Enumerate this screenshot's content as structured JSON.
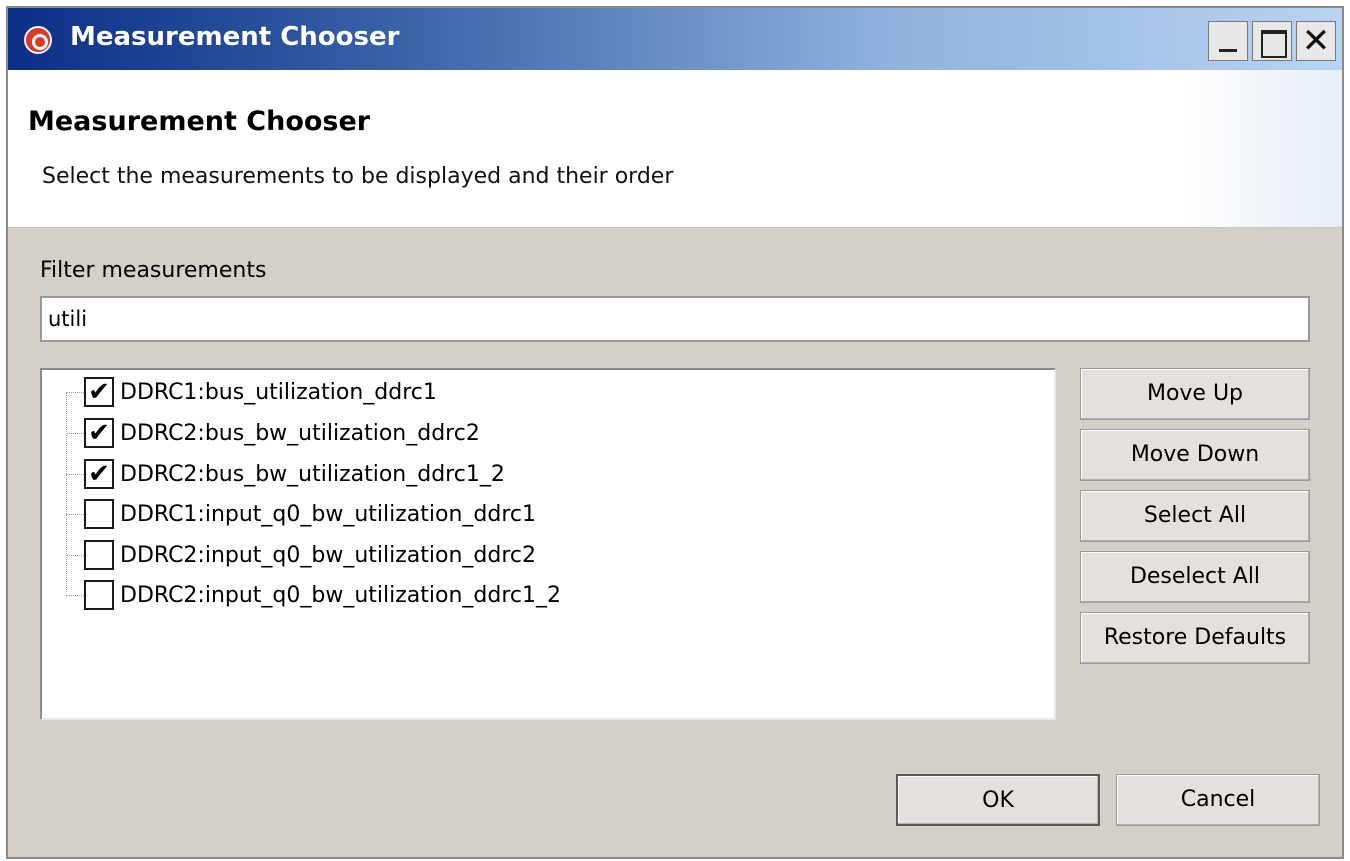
{
  "window": {
    "title": "Measurement Chooser",
    "controls": {
      "minimize": "_",
      "maximize": "□",
      "close": "✕"
    }
  },
  "banner": {
    "title": "Measurement Chooser",
    "subtitle": "Select the measurements to be displayed and their order"
  },
  "filter": {
    "label": "Filter measurements",
    "value": "utili"
  },
  "measurements": [
    {
      "label": "DDRC1:bus_utilization_ddrc1",
      "checked": true
    },
    {
      "label": "DDRC2:bus_bw_utilization_ddrc2",
      "checked": true
    },
    {
      "label": "DDRC2:bus_bw_utilization_ddrc1_2",
      "checked": true
    },
    {
      "label": "DDRC1:input_q0_bw_utilization_ddrc1",
      "checked": false
    },
    {
      "label": "DDRC2:input_q0_bw_utilization_ddrc2",
      "checked": false
    },
    {
      "label": "DDRC2:input_q0_bw_utilization_ddrc1_2",
      "checked": false
    }
  ],
  "side_buttons": {
    "move_up": "Move Up",
    "move_down": "Move Down",
    "select_all": "Select All",
    "deselect_all": "Deselect All",
    "restore_defaults": "Restore Defaults"
  },
  "footer": {
    "ok": "OK",
    "cancel": "Cancel"
  },
  "colors": {
    "titlebar_start": "#0b2e86",
    "titlebar_end": "#b9d4f2",
    "dialog_background": "#d4d0c8"
  },
  "icons": {
    "app": "app-logo-icon",
    "checked": "check-mark-icon"
  }
}
